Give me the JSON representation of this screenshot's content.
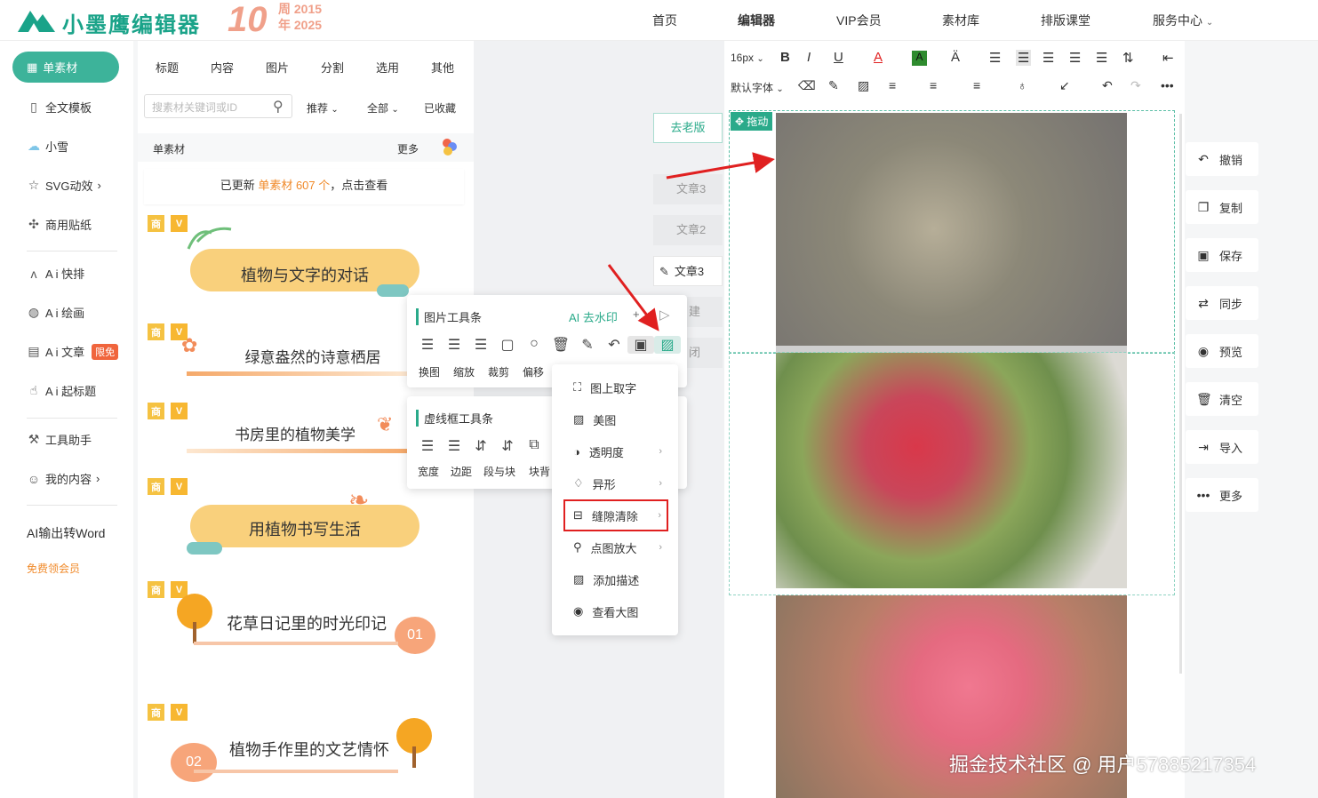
{
  "header": {
    "logo_text": "小墨鹰编辑器",
    "anniversary_num": "10",
    "anniversary_line1": "周 2015",
    "anniversary_line2": "年 2025",
    "nav": [
      "首页",
      "编辑器",
      "VIP会员",
      "素材库",
      "排版课堂",
      "服务中心"
    ]
  },
  "sidebar": {
    "active": "单素材",
    "items": [
      "全文模板",
      "小雪",
      "SVG动效",
      "商用贴纸",
      "A i 快排",
      "A i 绘画",
      "A i 文章",
      "A i 起标题",
      "工具助手",
      "我的内容",
      "AI输出转Word",
      "免费领会员"
    ],
    "limited_badge": "限免"
  },
  "panel": {
    "categories": [
      "标题",
      "内容",
      "图片",
      "分割",
      "选用",
      "其他"
    ],
    "search_placeholder": "搜素材关键词或ID",
    "filters": [
      "推荐",
      "全部",
      "已收藏"
    ],
    "section_label": "单素材",
    "section_more": "更多",
    "update_prefix": "已更新",
    "update_highlight": "单素材 607 个",
    "update_suffix": "，点击查看",
    "tag_shang": "商",
    "tag_v": "V",
    "cards": [
      "植物与文字的对话",
      "绿意盎然的诗意栖居",
      "书房里的植物美学",
      "用植物书写生活",
      "花草日记里的时光印记",
      "植物手作里的文艺情怀"
    ],
    "card_nums": [
      "01",
      "02"
    ]
  },
  "middle": {
    "old_version": "去老版",
    "articles": [
      "文章3",
      "文章2",
      "文章3"
    ],
    "partial_texts": [
      "建",
      "闭"
    ]
  },
  "image_toolbar": {
    "title": "图片工具条",
    "ai_watermark": "AI 去水印",
    "plus": "+",
    "labels": [
      "换图",
      "缩放",
      "裁剪",
      "偏移"
    ]
  },
  "dash_toolbar": {
    "title": "虚线框工具条",
    "labels": [
      "宽度",
      "边距",
      "段与块",
      "块背"
    ]
  },
  "context_menu": {
    "items": [
      "图上取字",
      "美图",
      "透明度",
      "异形",
      "缝隙清除",
      "点图放大",
      "添加描述",
      "查看大图"
    ]
  },
  "editor_toolbar": {
    "font_size": "16px",
    "font_family": "默认字体"
  },
  "canvas": {
    "drag_label": "拖动"
  },
  "right_actions": [
    "撤销",
    "复制",
    "保存",
    "同步",
    "预览",
    "清空",
    "导入",
    "更多"
  ],
  "watermark": "掘金技术社区 @ 用户57885217354",
  "colors": {
    "brand": "#3db39a",
    "highlight": "#f08a2a",
    "red": "#e02020"
  }
}
